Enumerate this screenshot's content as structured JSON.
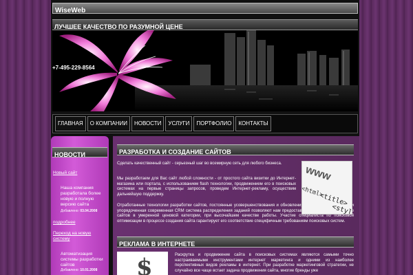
{
  "site": {
    "name": "WiseWeb",
    "slogan": "ЛУЧШЕЕ КАЧЕСТВО ПО РАЗУМНОЙ ЦЕНЕ",
    "phone": "+7-495-229-8564"
  },
  "nav": {
    "items": [
      "ГЛАВНАЯ",
      "О КОМПАНИИ",
      "НОВОСТИ",
      "УСЛУГИ",
      "ПОРТФОЛИО",
      "КОНТАКТЫ"
    ]
  },
  "sidebar": {
    "title": "НОВОСТИ",
    "link1": "Новый сайт",
    "news1_text": "Наша компания разработала более новую и полную версию сайта",
    "news1_date_label": "Добавлено:",
    "news1_date": "03.04.2008",
    "more": "подробнее",
    "link2": "Переход на новую систему",
    "news2_text": "Автоматизация системы разработки сайтов",
    "news2_date_label": "Добавлено:",
    "news2_date": "10.01.2008"
  },
  "main": {
    "section1_title": "РАЗРАБОТКА И СОЗДАНИЕ САЙТОВ",
    "section1_p1": "Сделать качественный сайт - серьезный шаг во всемирную сеть для любого бизнеса.",
    "section1_p2": "Мы разработаем для Вас сайт любой сложности - от простого сайта визитки до Интернет-магазина или портала, с использованием flash технологии, продвижением его в поисковых системах на первые страницы запросов, проведем Интернет-рекламу, осуществим дальнейшую поддержку.",
    "section1_p3": "Отработанные технологии разработки сайтов, постоянные усовершенствования и обновления программных решений и упорядоченная современная CRM система распределения заданий позволяют нам предоставлять услуги по разработке сайтов в умеренной ценовой категории, при высочайшем качестве работы. Участие специалиста по поисковой оптимизации в процессе создания сайта гарантирует его соответствие специфичным требованиям поисковых систем.",
    "section2_title": "РЕКЛАМА В ИНТЕРНЕТЕ",
    "section2_p1": "Раскрутка и продвижение сайта в поисковых системах являются самыми точно настраиваемыми инструментами интернет маркетинга и одними из наиболее перспективных видов рекламы в интернет. При разработке маркетинговой стратегии, не случайно все чаще встает задача продвижения сайта, многие бренды уже",
    "img1_text": "www",
    "img1_tag1": "<html>",
    "img1_tag2": "<title>",
    "img1_tag3": "<styl"
  },
  "colors": {
    "sidebar": "#c24bc8",
    "main_bg": "#5f2c63",
    "page_bg": "#5a2a5c",
    "title_bar": "#4a4a4a"
  }
}
